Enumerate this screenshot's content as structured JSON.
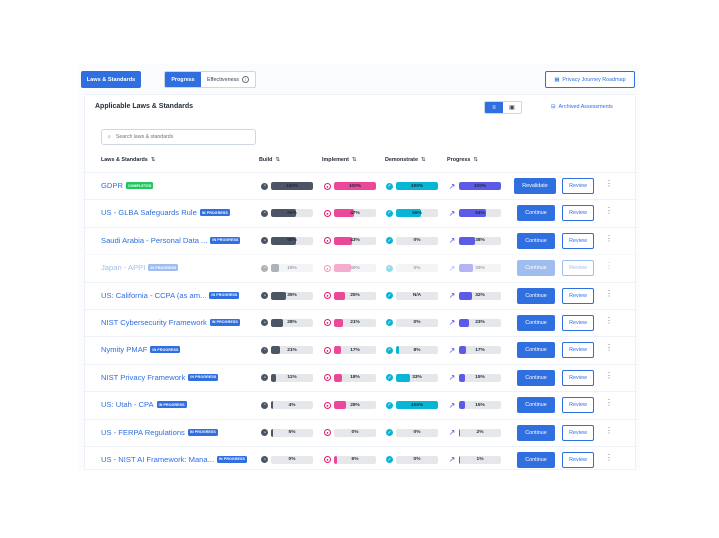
{
  "header": {
    "laws_button": "Laws & Standards",
    "tabs": [
      {
        "label": "Progress",
        "active": true
      },
      {
        "label": "Effectiveness",
        "active": false
      }
    ],
    "roadmap_button": "Privacy Journey Roadmap"
  },
  "card": {
    "title": "Applicable Laws & Standards",
    "archived_link": "Archived Assessments",
    "search_placeholder": "Search laws & standards"
  },
  "columns": {
    "law": "Laws & Standards",
    "build": "Build",
    "implement": "Implement",
    "demonstrate": "Demonstrate",
    "progress": "Progress"
  },
  "colors": {
    "accent": "#2f6fe0",
    "build": "#4b5563",
    "implement": "#ec4899",
    "demonstrate": "#06b6d4",
    "progress": "#5b5be6",
    "completed_badge": "#22c55e"
  },
  "rows": [
    {
      "name": "GDPR",
      "status": "COMPLETED",
      "build": "100%",
      "build_v": 100,
      "implement": "100%",
      "implement_v": 100,
      "demonstrate": "100%",
      "demonstrate_v": 100,
      "progress": "100%",
      "progress_v": 100,
      "action": "Revalidate",
      "review": "Review",
      "disabled": false
    },
    {
      "name": "US - GLBA Safeguards Rule",
      "status": "IN PROGRESS",
      "build": "60%",
      "build_v": 60,
      "implement": "47%",
      "implement_v": 47,
      "demonstrate": "59%",
      "demonstrate_v": 59,
      "progress": "64%",
      "progress_v": 64,
      "action": "Continue",
      "review": "Review",
      "disabled": false
    },
    {
      "name": "Saudi Arabia - Personal Data ...",
      "status": "IN PROGRESS",
      "build": "60%",
      "build_v": 60,
      "implement": "43%",
      "implement_v": 43,
      "demonstrate": "0%",
      "demonstrate_v": 0,
      "progress": "38%",
      "progress_v": 38,
      "action": "Continue",
      "review": "Review",
      "disabled": false
    },
    {
      "name": "Japan - APPI",
      "status": "IN PROGRESS",
      "build": "19%",
      "build_v": 19,
      "implement": "40%",
      "implement_v": 40,
      "demonstrate": "0%",
      "demonstrate_v": 0,
      "progress": "33%",
      "progress_v": 33,
      "action": "Continue",
      "review": "Review",
      "disabled": true
    },
    {
      "name": "US: California - CCPA (as am...",
      "status": "IN PROGRESS",
      "build": "35%",
      "build_v": 35,
      "implement": "25%",
      "implement_v": 25,
      "demonstrate": "N/A",
      "demonstrate_v": 0,
      "progress": "32%",
      "progress_v": 32,
      "action": "Continue",
      "review": "Review",
      "disabled": false
    },
    {
      "name": "NIST Cybersecurity Framework",
      "status": "IN PROGRESS",
      "build": "28%",
      "build_v": 28,
      "implement": "21%",
      "implement_v": 21,
      "demonstrate": "0%",
      "demonstrate_v": 0,
      "progress": "23%",
      "progress_v": 23,
      "action": "Continue",
      "review": "Review",
      "disabled": false
    },
    {
      "name": "Nymity PMAF",
      "status": "IN PROGRESS",
      "build": "21%",
      "build_v": 21,
      "implement": "17%",
      "implement_v": 17,
      "demonstrate": "8%",
      "demonstrate_v": 8,
      "progress": "17%",
      "progress_v": 17,
      "action": "Continue",
      "review": "Review",
      "disabled": false
    },
    {
      "name": "NIST Privacy Framework",
      "status": "IN PROGRESS",
      "build": "11%",
      "build_v": 11,
      "implement": "18%",
      "implement_v": 18,
      "demonstrate": "33%",
      "demonstrate_v": 33,
      "progress": "15%",
      "progress_v": 15,
      "action": "Continue",
      "review": "Review",
      "disabled": false
    },
    {
      "name": "US: Utah - CPA",
      "status": "IN PROGRESS",
      "build": "4%",
      "build_v": 4,
      "implement": "28%",
      "implement_v": 28,
      "demonstrate": "100%",
      "demonstrate_v": 100,
      "progress": "15%",
      "progress_v": 15,
      "action": "Continue",
      "review": "Review",
      "disabled": false
    },
    {
      "name": "US - FERPA Regulations",
      "status": "IN PROGRESS",
      "build": "5%",
      "build_v": 5,
      "implement": "0%",
      "implement_v": 0,
      "demonstrate": "0%",
      "demonstrate_v": 0,
      "progress": "2%",
      "progress_v": 2,
      "action": "Continue",
      "review": "Review",
      "disabled": false
    },
    {
      "name": "US - NIST AI Framework: Mana...",
      "status": "IN PROGRESS",
      "build": "0%",
      "build_v": 0,
      "implement": "6%",
      "implement_v": 6,
      "demonstrate": "0%",
      "demonstrate_v": 0,
      "progress": "1%",
      "progress_v": 1,
      "action": "Continue",
      "review": "Review",
      "disabled": false
    }
  ]
}
